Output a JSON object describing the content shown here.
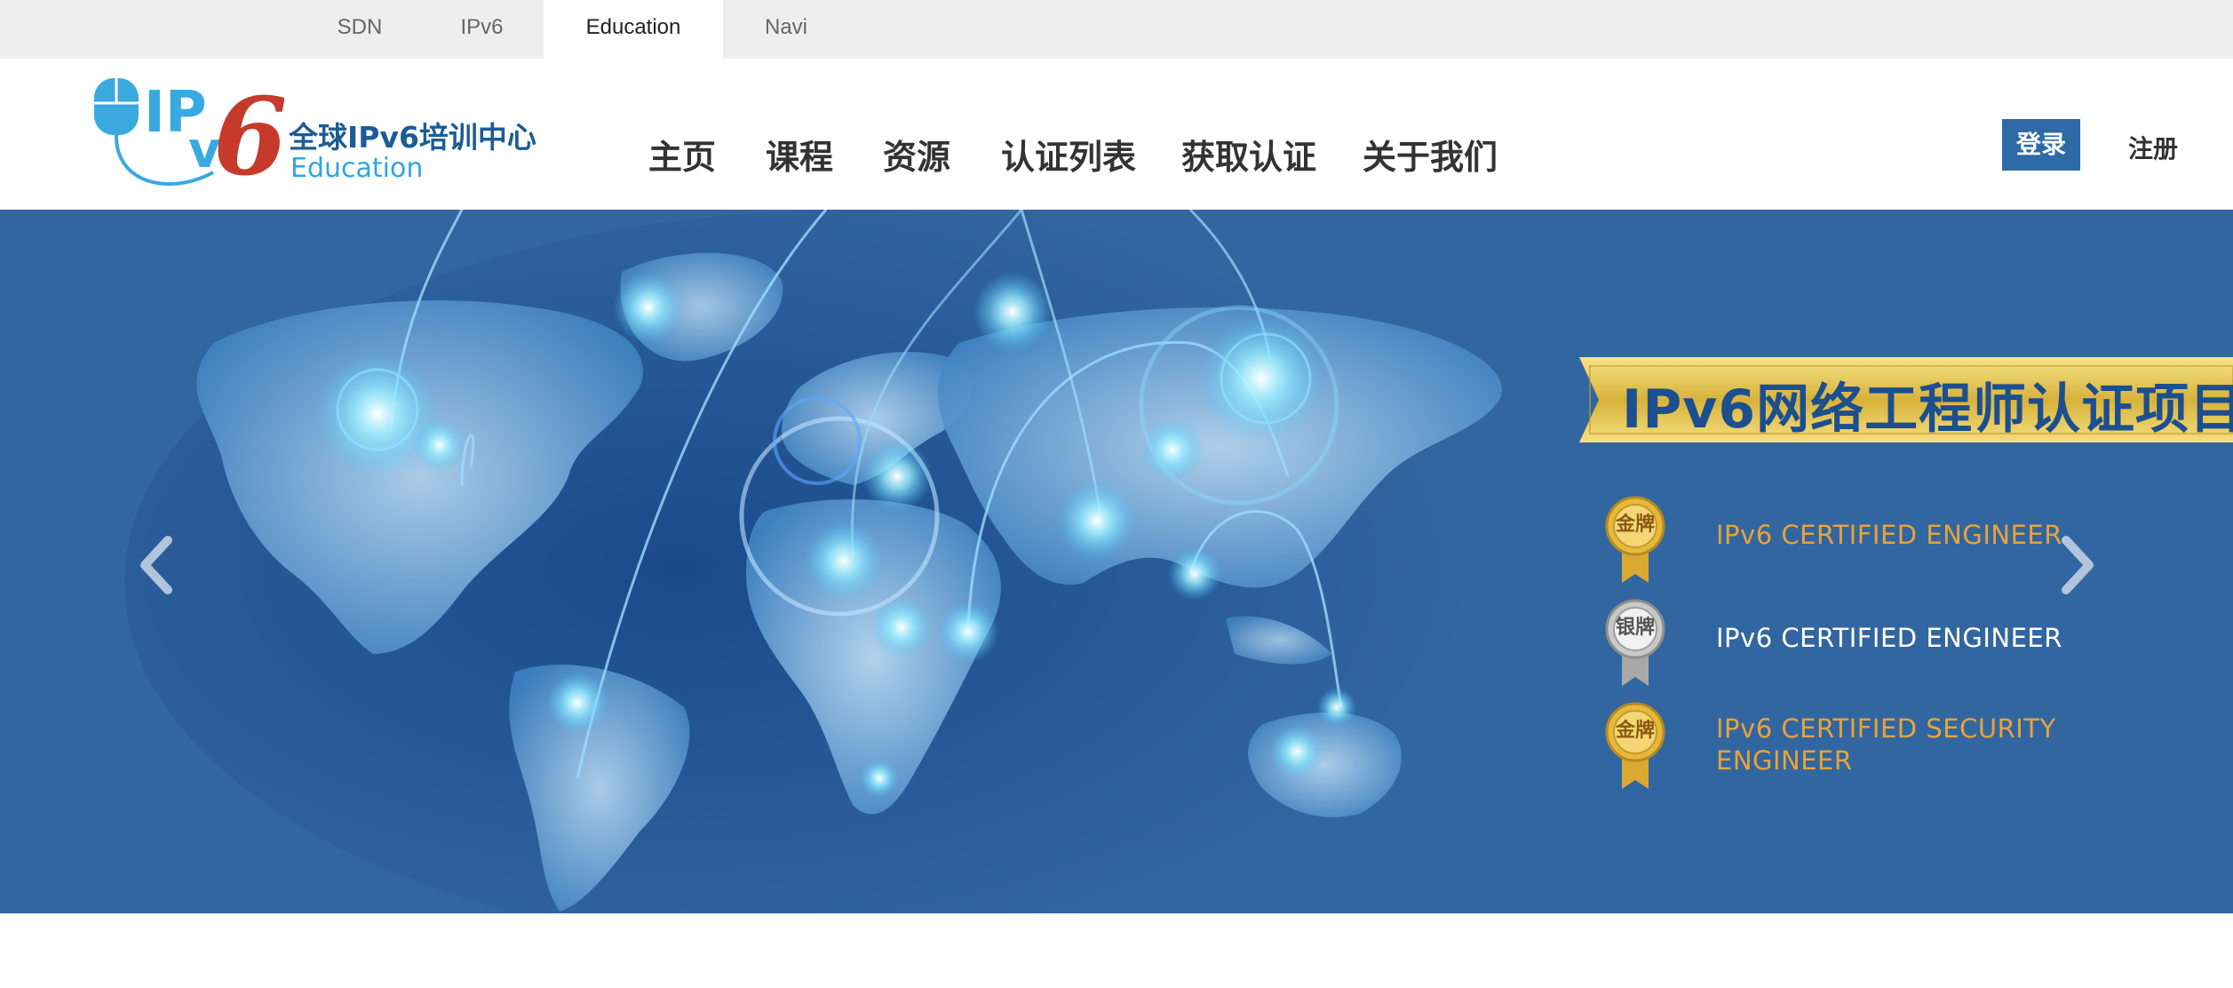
{
  "site_tabs": [
    {
      "label": "SDN"
    },
    {
      "label": "IPv6"
    },
    {
      "label": "Education"
    },
    {
      "label": "Navi"
    }
  ],
  "active_tab": "Education",
  "logo": {
    "mark_text": "IPv6",
    "cn_title": "全球IPv6培训中心",
    "en_title": "Education"
  },
  "nav": {
    "items": [
      {
        "label": "主页"
      },
      {
        "label": "课程"
      },
      {
        "label": "资源"
      },
      {
        "label": "认证列表"
      },
      {
        "label": "获取认证"
      },
      {
        "label": "关于我们"
      }
    ]
  },
  "account": {
    "login_label": "登录",
    "register_label": "注册"
  },
  "banner": {
    "ribbon_title": "IPv6网络工程师认证项目",
    "certs": [
      {
        "medal": "金牌",
        "medal_type": "gold",
        "label_lines": [
          "IPv6 CERTIFIED ENGINEER"
        ],
        "color": "#e8a33a"
      },
      {
        "medal": "银牌",
        "medal_type": "silver",
        "label_lines": [
          "IPv6 CERTIFIED ENGINEER"
        ],
        "color": "#ffffff"
      },
      {
        "medal": "金牌",
        "medal_type": "gold",
        "label_lines": [
          "IPv6 CERTIFIED SECURITY",
          "ENGINEER"
        ],
        "color": "#e8a33a"
      }
    ],
    "prev_icon": "chevron-left-icon",
    "next_icon": "chevron-right-icon"
  },
  "colors": {
    "topbar_bg": "#eeeeee",
    "brand_blue": "#2d6aa6",
    "banner_bg": "#3266a0",
    "gold_text": "#e8a33a"
  }
}
